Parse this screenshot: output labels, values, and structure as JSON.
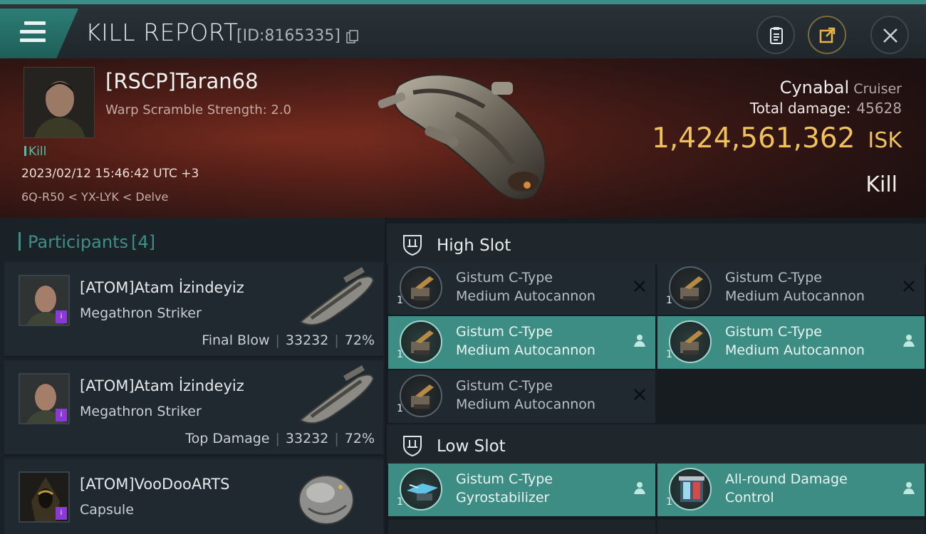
{
  "header": {
    "title": "KILL REPORT",
    "report_id": "[ID:8165335]"
  },
  "victim": {
    "pilot": "[RSCP]Taran68",
    "scramble": "Warp Scramble Strength:  2.0",
    "kill_tag": "Kill",
    "datetime": "2023/02/12 15:46:42 UTC +3",
    "location": "6Q-R50 < YX-LYK < Delve",
    "ship_name": "Cynabal",
    "ship_class": "Cruiser",
    "total_damage_label": "Total damage:",
    "total_damage": "45628",
    "isk_value": "1,424,561,362",
    "isk_unit": "ISK",
    "result": "Kill"
  },
  "participants": {
    "title": "Participants",
    "count": "[4]",
    "rows": [
      {
        "name": "[ATOM]Atam İzindeyiz",
        "ship": "Megathron Striker",
        "role": "Final Blow",
        "damage": "33232",
        "percent": "72%"
      },
      {
        "name": "[ATOM]Atam İzindeyiz",
        "ship": "Megathron Striker",
        "role": "Top Damage",
        "damage": "33232",
        "percent": "72%"
      },
      {
        "name": "[ATOM]VooDooARTS",
        "ship": "Capsule",
        "role": "",
        "damage": "",
        "percent": ""
      }
    ]
  },
  "slots": {
    "high": {
      "label": "High Slot",
      "modules": [
        {
          "name1": "Gistum C-Type",
          "name2": "Medium Autocannon",
          "qty": "1",
          "state": "destroyed"
        },
        {
          "name1": "Gistum C-Type",
          "name2": "Medium Autocannon",
          "qty": "1",
          "state": "destroyed"
        },
        {
          "name1": "Gistum C-Type",
          "name2": "Medium Autocannon",
          "qty": "1",
          "state": "dropped"
        },
        {
          "name1": "Gistum C-Type",
          "name2": "Medium Autocannon",
          "qty": "1",
          "state": "dropped"
        },
        {
          "name1": "Gistum C-Type",
          "name2": "Medium Autocannon",
          "qty": "1",
          "state": "destroyed"
        }
      ]
    },
    "low": {
      "label": "Low Slot",
      "modules": [
        {
          "name1": "Gistum C-Type",
          "name2": "Gyrostabilizer",
          "qty": "1",
          "state": "dropped"
        },
        {
          "name1": "All-round Damage",
          "name2": "Control",
          "qty": "1",
          "state": "dropped"
        }
      ]
    }
  },
  "colors": {
    "accent": "#3e8d84",
    "isk_gold": "#f1c15b",
    "rarity_badge": "#8a38d6"
  }
}
